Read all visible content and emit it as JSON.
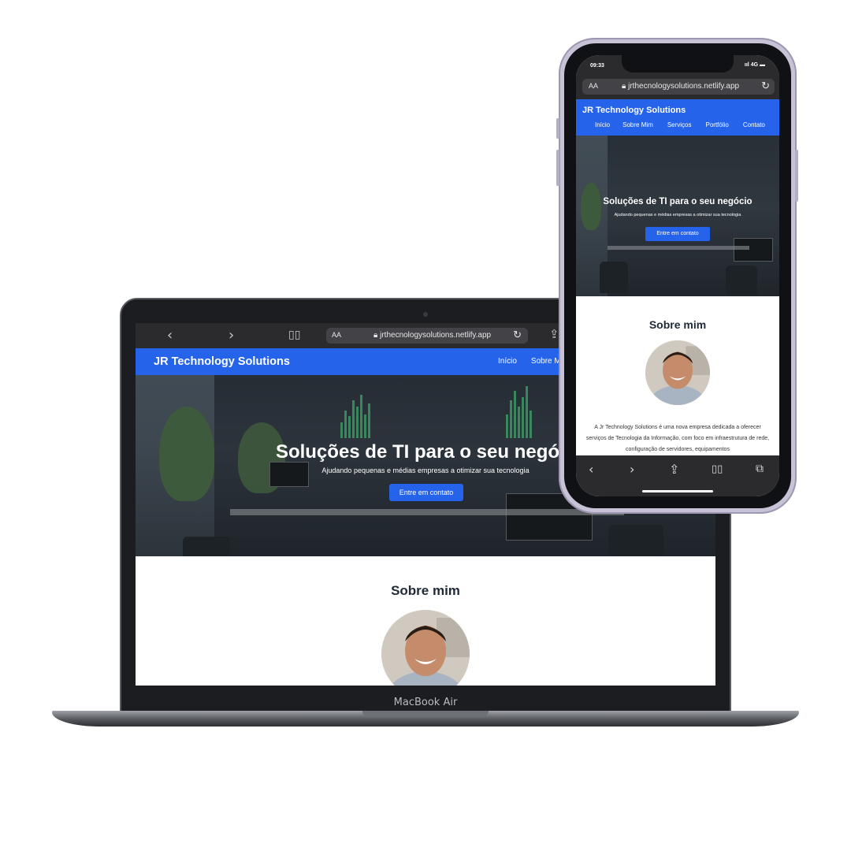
{
  "site": {
    "brand": "JR Technology Solutions",
    "url": "jrthecnologysolutions.netlify.app",
    "nav": [
      "Início",
      "Sobre Mim",
      "Serviços",
      "Portfólio",
      "Contato"
    ],
    "laptop_nav_visible": [
      "Início",
      "Sobre M"
    ],
    "hero": {
      "title": "Soluções de TI para o seu negócio",
      "subtitle": "Ajudando pequenas e médias empresas a otimizar sua tecnologia",
      "cta": "Entre em contato"
    },
    "about": {
      "title": "Sobre mim",
      "text": "A Jr Technology Solutions é uma nova empresa dedicada a oferecer serviços de Tecnologia da Informação, com foco em infraestrutura de rede, configuração de servidores, equipamentos"
    }
  },
  "laptop": {
    "model_label": "MacBook Air",
    "laptop_hero_title_visible": "Soluções de TI para o seu negóci",
    "browser": {
      "text_size": "AA",
      "back": "<",
      "forward": ">"
    }
  },
  "phone": {
    "time": "09:33",
    "network": "4G",
    "text_size": "AA"
  },
  "colors": {
    "brand_blue": "#2563eb",
    "browser_chrome": "#2b2b2e"
  },
  "icons": [
    "back-icon",
    "forward-icon",
    "bookmarks-icon",
    "lock-icon",
    "reload-icon",
    "share-icon",
    "tabs-icon",
    "signal-icon",
    "battery-icon"
  ]
}
